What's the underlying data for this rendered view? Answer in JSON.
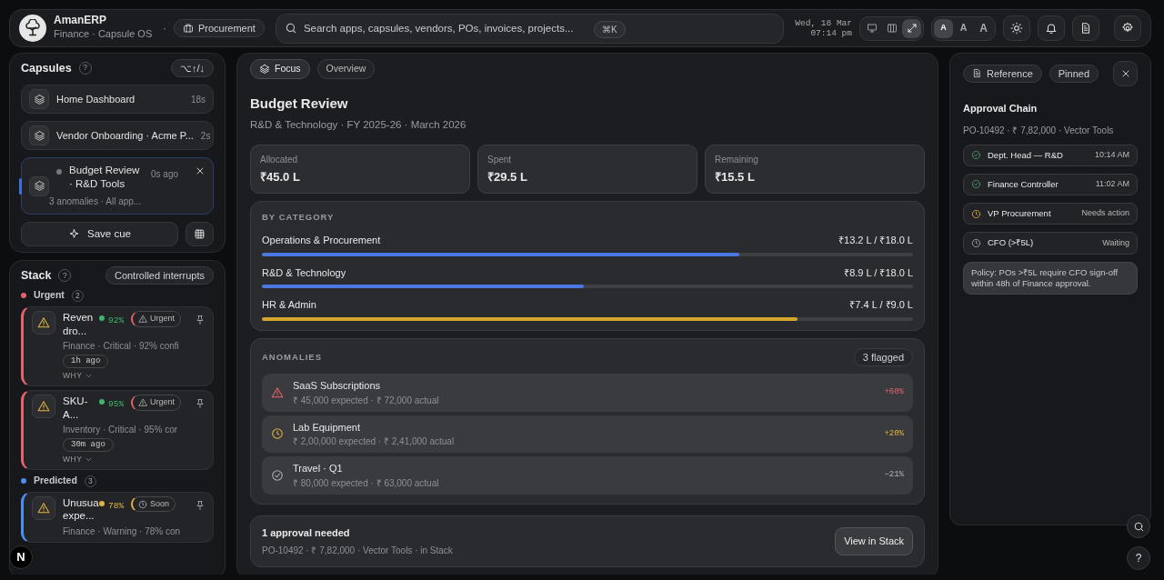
{
  "header": {
    "brand": "AmanERP",
    "subtitle": "Finance · Capsule OS",
    "separator": "·",
    "module": "Procurement",
    "search": {
      "placeholder": "Search apps, capsules, vendors, POs, invoices, projects...",
      "shortcut": "⌘K"
    },
    "date": "Wed, 18 Mar",
    "time": "07:14 pm",
    "view_modes": [
      {
        "kind": "monitor",
        "selected": false
      },
      {
        "kind": "columns",
        "selected": false
      },
      {
        "kind": "expand",
        "selected": true
      }
    ],
    "text_sizes": [
      {
        "label": "A",
        "selected": true
      },
      {
        "label": "A",
        "selected": false
      },
      {
        "label": "A",
        "selected": false
      }
    ],
    "actions": [
      {
        "kind": "theme"
      },
      {
        "kind": "notifications"
      },
      {
        "kind": "document"
      },
      {
        "kind": "settings"
      }
    ]
  },
  "capsules": {
    "title": "Capsules",
    "help": "?",
    "shortcut": "⌥↑/↓",
    "items": [
      {
        "title": "Home Dashboard",
        "time": "18s",
        "selected": false
      },
      {
        "title": "Vendor Onboarding · Acme P...",
        "time": "2s",
        "selected": false
      },
      {
        "title": "Budget Review · R&D Tools",
        "time": "0s ago",
        "detail": "3 anomalies · All app...",
        "selected": true
      }
    ],
    "save_label": "Save cue"
  },
  "stack": {
    "title": "Stack",
    "help": "?",
    "mode": "Controlled interrupts",
    "groups": [
      {
        "label": "Urgent",
        "count": "2",
        "color": "#e5636a",
        "items": [
          {
            "title": "Reven dro...",
            "confidence": {
              "value": "92%",
              "color": "#3fb66b"
            },
            "tag": {
              "kind": "urgent",
              "label": "Urgent"
            },
            "meta": "Finance · Critical · 92% confi",
            "age": "1h ago",
            "why": "WHY"
          },
          {
            "title": "SKU- A...",
            "confidence": {
              "value": "95%",
              "color": "#3fb66b"
            },
            "tag": {
              "kind": "urgent",
              "label": "Urgent"
            },
            "meta": "Inventory · Critical · 95% cor",
            "age": "30m ago",
            "why": "WHY"
          }
        ]
      },
      {
        "label": "Predicted",
        "count": "3",
        "color": "#4f8df0",
        "items": [
          {
            "title": "Unusua expe...",
            "confidence": {
              "value": "78%",
              "color": "#e2b43c"
            },
            "tag": {
              "kind": "soon",
              "label": "Soon"
            },
            "meta": "Finance · Warning · 78% con"
          }
        ]
      }
    ]
  },
  "main": {
    "tabs": [
      {
        "label": "Focus",
        "selected": true
      },
      {
        "label": "Overview",
        "selected": false
      }
    ],
    "title": "Budget Review",
    "subtitle": "R&D & Technology · FY 2025-26 · March 2026",
    "stats": [
      {
        "label": "Allocated",
        "value": "₹45.0 L"
      },
      {
        "label": "Spent",
        "value": "₹29.5 L"
      },
      {
        "label": "Remaining",
        "value": "₹15.5 L"
      }
    ],
    "categories": {
      "heading": "BY CATEGORY",
      "items": [
        {
          "name": "Operations & Procurement",
          "amount": "₹13.2 L / ₹18.0 L",
          "level": 0.733,
          "color": "#4a78e0"
        },
        {
          "name": "R&D & Technology",
          "amount": "₹8.9 L / ₹18.0 L",
          "level": 0.494,
          "color": "#4a78e0"
        },
        {
          "name": "HR & Admin",
          "amount": "₹7.4 L / ₹9.0 L",
          "level": 0.822,
          "color": "#d4a72c"
        }
      ]
    },
    "anomalies": {
      "heading": "ANOMALIES",
      "badge": "3 flagged",
      "items": [
        {
          "kind": "over",
          "title": "SaaS Subscriptions",
          "detail": "₹ 45,000 expected · ₹ 72,000 actual",
          "delta": "+60%"
        },
        {
          "kind": "watch",
          "title": "Lab Equipment",
          "detail": "₹ 2,00,000 expected · ₹ 2,41,000 actual",
          "delta": "+20%"
        },
        {
          "kind": "under",
          "title": "Travel · Q1",
          "detail": "₹ 80,000 expected · ₹ 63,000 actual",
          "delta": "−21%"
        }
      ]
    },
    "approval": {
      "title": "1 approval needed",
      "detail": "PO-10492 · ₹ 7,82,000 · Vector Tools · in Stack",
      "action": "View in Stack"
    }
  },
  "reference": {
    "chips": [
      {
        "kind": "document",
        "label": "Reference"
      },
      {
        "kind": "plain",
        "label": "Pinned"
      }
    ],
    "title": "Approval Chain",
    "subtitle": "PO-10492 · ₹ 7,82,000 · Vector Tools",
    "steps": [
      {
        "name": "Dept. Head — R&D",
        "kind": "done",
        "note": "10:14 AM"
      },
      {
        "name": "Finance Controller",
        "kind": "done",
        "note": "11:02 AM"
      },
      {
        "name": "VP Procurement",
        "kind": "action",
        "note": "Needs action"
      },
      {
        "name": "CFO (>₹5L)",
        "kind": "waiting",
        "note": "Waiting"
      }
    ],
    "policy": "Policy: POs >₹5L require CFO sign-off within 48h of Finance approval."
  },
  "floating": {
    "dev_badge": "N",
    "help": "?"
  }
}
